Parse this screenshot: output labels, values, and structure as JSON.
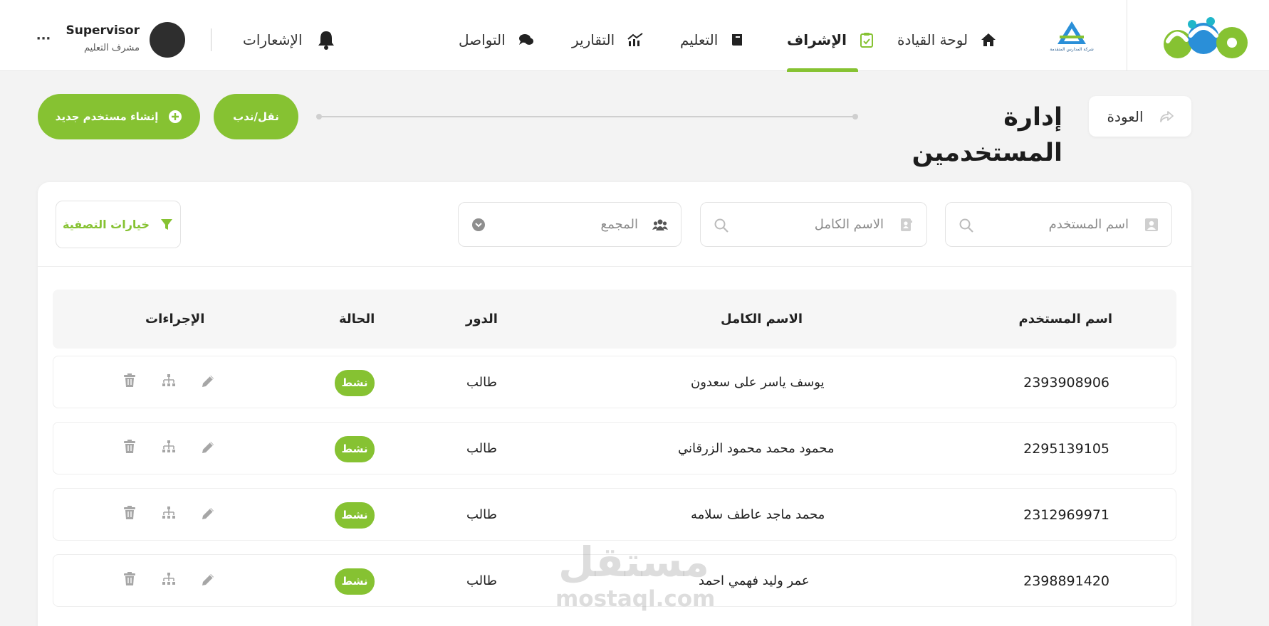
{
  "header": {
    "company_logo_caption": "شركة المدارس المتقدمة",
    "nav": [
      {
        "label": "لوحة القيادة",
        "icon": "home-icon"
      },
      {
        "label": "الإشراف",
        "icon": "clipboard-check-icon",
        "active": true
      },
      {
        "label": "التعليم",
        "icon": "book-icon"
      },
      {
        "label": "التقارير",
        "icon": "chart-icon"
      },
      {
        "label": "التواصل",
        "icon": "chat-icon"
      }
    ],
    "notifications_label": "الإشعارات",
    "user": {
      "name": "Supervisor",
      "role": "مشرف التعليم"
    },
    "more_label": "···"
  },
  "toolbar": {
    "back_label": "العودة",
    "page_title": "إدارة المستخدمين",
    "transfer_label": "نقل/ندب",
    "create_label": "إنشاء مستخدم جديد"
  },
  "filters": {
    "username_placeholder": "اسم المستخدم",
    "fullname_placeholder": "الاسم الكامل",
    "complex_placeholder": "المجمع",
    "filter_options_label": "خيارات التصفية"
  },
  "table": {
    "columns": {
      "username": "اسم المستخدم",
      "fullname": "الاسم الكامل",
      "role": "الدور",
      "status": "الحالة",
      "actions": "الإجراءات"
    },
    "rows": [
      {
        "username": "2393908906",
        "fullname": "يوسف ياسر على سعدون",
        "role": "طالب",
        "status": "نشط"
      },
      {
        "username": "2295139105",
        "fullname": "محمود محمد محمود الزرقاني",
        "role": "طالب",
        "status": "نشط"
      },
      {
        "username": "2312969971",
        "fullname": "محمد ماجد عاطف سلامه",
        "role": "طالب",
        "status": "نشط"
      },
      {
        "username": "2398891420",
        "fullname": "عمر وليد فهمي احمد",
        "role": "طالب",
        "status": "نشط"
      }
    ]
  },
  "watermark": {
    "arabic": "مستقل",
    "latin": "mostaql.com"
  },
  "colors": {
    "accent": "#86c232",
    "logo_blue": "#2a8fd8",
    "logo_teal": "#1fb6c9"
  }
}
